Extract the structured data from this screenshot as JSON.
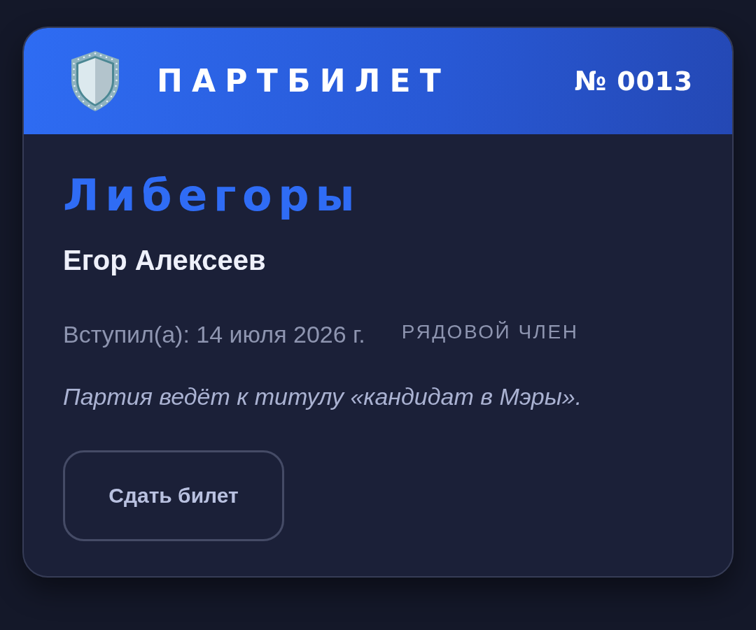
{
  "header": {
    "title": "ПАРТБИЛЕТ",
    "number": "№ 0013"
  },
  "party": {
    "name": "Либегоры"
  },
  "member": {
    "name": "Егор Алексеев",
    "joined": "Вступил(а): 14 июля 2026 г.",
    "rank": "РЯДОВОЙ ЧЛЕН"
  },
  "motto": "Партия ведёт к титулу «кандидат в Мэры».",
  "buttons": [
    {
      "label": "Сдать билет"
    }
  ]
}
